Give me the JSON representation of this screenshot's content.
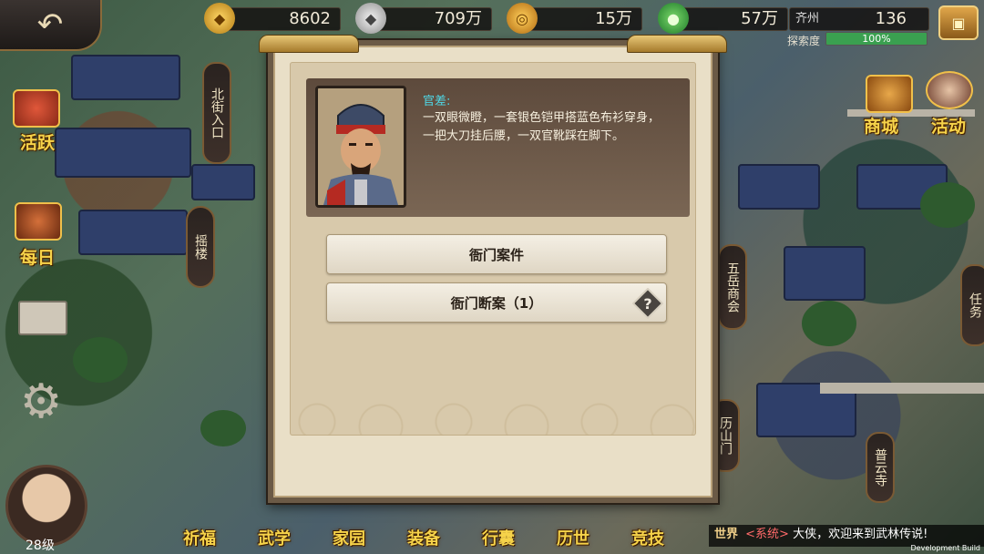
{
  "top_bar": {
    "back_icon": "back-arrow-icon",
    "resources": [
      {
        "name": "gold-ingot",
        "icon": "gold-ingot-icon",
        "value": "8602"
      },
      {
        "name": "silver",
        "icon": "silver-ingot-icon",
        "value": "709万"
      },
      {
        "name": "coin",
        "icon": "copper-coin-icon",
        "value": "15万"
      },
      {
        "name": "jade",
        "icon": "jade-token-icon",
        "value": "57万"
      },
      {
        "name": "chest",
        "icon": "treasure-chest-icon",
        "value": "136"
      }
    ],
    "location_label": "齐州",
    "explore_label": "探索度",
    "explore_value": "100%",
    "explore_fraction": 1.0
  },
  "left_menu": {
    "active_label": "活跃",
    "daily_label": "每日"
  },
  "map_labels": {
    "north_gate": "北街入口",
    "tower": "摇楼",
    "wuyue": "五岳商会",
    "lishan": "历山门",
    "temple": "普云寺",
    "task": "任务"
  },
  "right_menu": {
    "shop_label": "商城",
    "event_label": "活动"
  },
  "player": {
    "level": "28级"
  },
  "bottom_menu": [
    "祈福",
    "武学",
    "家园",
    "装备",
    "行囊",
    "历世",
    "竞技"
  ],
  "chat": {
    "channel": "世界",
    "system_tag": "<系统>",
    "message": "大侠，欢迎来到武林传说!"
  },
  "dev_build": "Development Build",
  "dialog": {
    "npc_name": "官差:",
    "npc_desc": "一双眼微瞪，一套银色铠甲搭蓝色布衫穿身，一把大刀挂后腰，一双官靴踩在脚下。",
    "options": [
      {
        "label": "衙门案件"
      },
      {
        "label": "衙门断案（1）"
      }
    ]
  }
}
